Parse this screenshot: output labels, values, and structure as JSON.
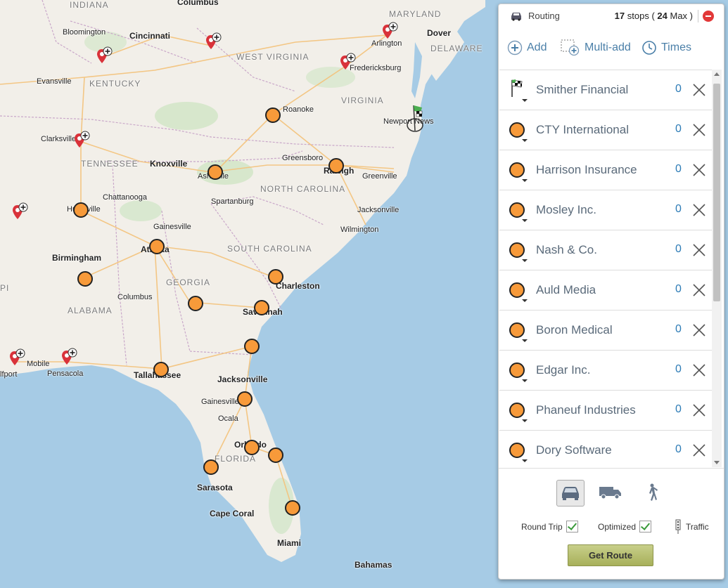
{
  "map": {
    "state_labels": [
      {
        "id": "indiana",
        "text": "INDIANA"
      },
      {
        "id": "maryland",
        "text": "MARYLAND"
      },
      {
        "id": "delaware",
        "text": "DELAWARE"
      },
      {
        "id": "west-virginia",
        "text": "WEST VIRGINIA"
      },
      {
        "id": "kentucky",
        "text": "KENTUCKY"
      },
      {
        "id": "virginia",
        "text": "VIRGINIA"
      },
      {
        "id": "tennessee",
        "text": "TENNESSEE"
      },
      {
        "id": "north-carolina",
        "text": "NORTH CAROLINA"
      },
      {
        "id": "south-carolina",
        "text": "SOUTH CAROLINA"
      },
      {
        "id": "georgia",
        "text": "GEORGIA"
      },
      {
        "id": "alabama",
        "text": "ALABAMA"
      },
      {
        "id": "florida",
        "text": "FLORIDA"
      },
      {
        "id": "mississippi-partial",
        "text": "PI"
      }
    ],
    "city_labels": [
      {
        "id": "columbus-oh",
        "text": "Columbus"
      },
      {
        "id": "cincinnati",
        "text": "Cincinnati"
      },
      {
        "id": "bloomington",
        "text": "Bloomington"
      },
      {
        "id": "dover",
        "text": "Dover"
      },
      {
        "id": "arlington",
        "text": "Arlington"
      },
      {
        "id": "fredericksburg",
        "text": "Fredericksburg"
      },
      {
        "id": "evansville",
        "text": "Evansville"
      },
      {
        "id": "roanoke",
        "text": "Roanoke"
      },
      {
        "id": "newport-news",
        "text": "Newport News"
      },
      {
        "id": "clarksville",
        "text": "Clarksville"
      },
      {
        "id": "knoxville",
        "text": "Knoxville"
      },
      {
        "id": "greensboro",
        "text": "Greensboro"
      },
      {
        "id": "raleigh",
        "text": "Raleigh"
      },
      {
        "id": "greenville-nc",
        "text": "Greenville"
      },
      {
        "id": "asheville",
        "text": "Asheville"
      },
      {
        "id": "chattanooga",
        "text": "Chattanooga"
      },
      {
        "id": "spartanburg",
        "text": "Spartanburg"
      },
      {
        "id": "jacksonville-nc",
        "text": "Jacksonville"
      },
      {
        "id": "huntsville",
        "text": "Huntsville"
      },
      {
        "id": "gainesville-ga",
        "text": "Gainesville"
      },
      {
        "id": "wilmington",
        "text": "Wilmington"
      },
      {
        "id": "atlanta",
        "text": "Atlanta"
      },
      {
        "id": "birmingham",
        "text": "Birmingham"
      },
      {
        "id": "charleston",
        "text": "Charleston"
      },
      {
        "id": "columbus-ga",
        "text": "Columbus"
      },
      {
        "id": "savannah",
        "text": "Savannah"
      },
      {
        "id": "mobile",
        "text": "Mobile"
      },
      {
        "id": "gulfport",
        "text": "lfport"
      },
      {
        "id": "pensacola",
        "text": "Pensacola"
      },
      {
        "id": "tallahassee",
        "text": "Tallahassee"
      },
      {
        "id": "jacksonville-fl",
        "text": "Jacksonville"
      },
      {
        "id": "gainesville-fl",
        "text": "Gainesville"
      },
      {
        "id": "ocala",
        "text": "Ocala"
      },
      {
        "id": "orlando",
        "text": "Orlando"
      },
      {
        "id": "sarasota",
        "text": "Sarasota"
      },
      {
        "id": "cape-coral",
        "text": "Cape Coral"
      },
      {
        "id": "miami",
        "text": "Miami"
      },
      {
        "id": "bahamas",
        "text": "Bahamas"
      }
    ],
    "colors": {
      "water": "#a6cbe5",
      "land": "#f2efe9",
      "park": "#cfe5c4",
      "road": "#f4c27a",
      "border": "#c9a7c9",
      "stop": "#f79a3a",
      "pin": "#d9323a"
    }
  },
  "panel": {
    "title": "Routing",
    "stops_count": "17",
    "stops_word": "stops (",
    "max_count": "24",
    "max_word": "Max )",
    "close_icon": "remove-circle-icon",
    "toolbar": {
      "add_label": "Add",
      "multi_add_label": "Multi-add",
      "times_label": "Times"
    },
    "stops": [
      {
        "name": "Smither Financial",
        "duration": "0",
        "marker": "checkered-flag-icon"
      },
      {
        "name": "CTY International",
        "duration": "0",
        "marker": "orange-circle"
      },
      {
        "name": "Harrison Insurance",
        "duration": "0",
        "marker": "orange-circle"
      },
      {
        "name": "Mosley Inc.",
        "duration": "0",
        "marker": "orange-circle"
      },
      {
        "name": "Nash & Co.",
        "duration": "0",
        "marker": "orange-circle"
      },
      {
        "name": "Auld Media",
        "duration": "0",
        "marker": "orange-circle"
      },
      {
        "name": "Boron Medical",
        "duration": "0",
        "marker": "orange-circle"
      },
      {
        "name": "Edgar Inc.",
        "duration": "0",
        "marker": "orange-circle"
      },
      {
        "name": "Phaneuf Industries",
        "duration": "0",
        "marker": "orange-circle"
      },
      {
        "name": "Dory Software",
        "duration": "0",
        "marker": "orange-circle"
      }
    ],
    "modes": [
      "car-icon",
      "truck-icon",
      "walk-icon"
    ],
    "options": {
      "round_trip_label": "Round Trip",
      "optimized_label": "Optimized",
      "traffic_label": "Traffic"
    },
    "get_route_label": "Get Route"
  }
}
